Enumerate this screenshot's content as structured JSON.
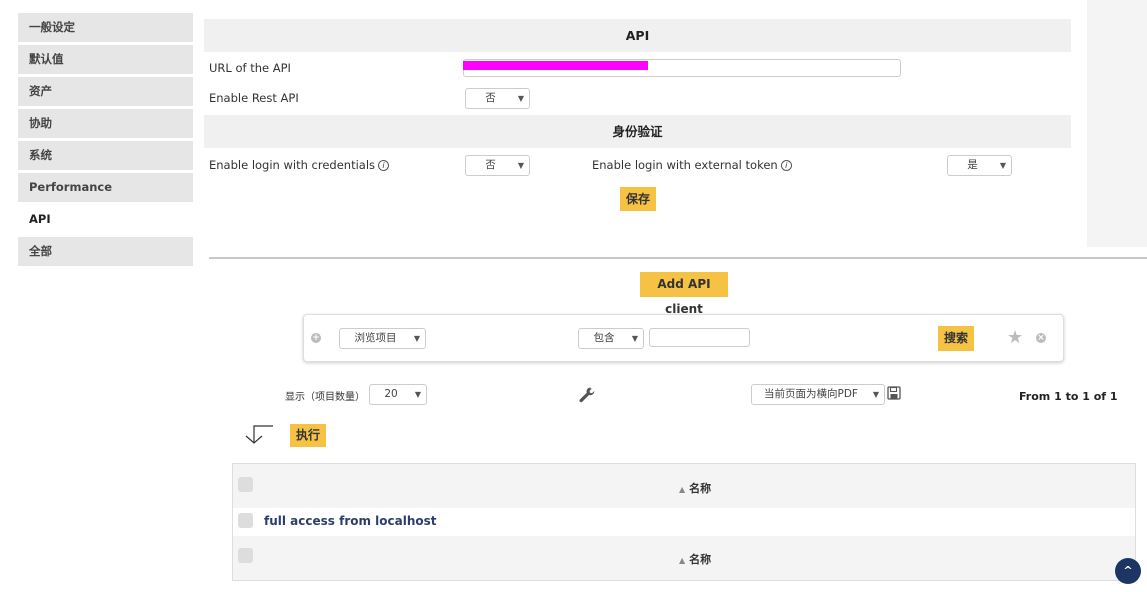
{
  "sidebar": {
    "items": [
      {
        "label": "一般设定"
      },
      {
        "label": "默认值"
      },
      {
        "label": "资产"
      },
      {
        "label": "协助"
      },
      {
        "label": "系统"
      },
      {
        "label": "Performance"
      },
      {
        "label": "API"
      },
      {
        "label": "全部"
      }
    ],
    "active": "API"
  },
  "api_section": {
    "title": "API",
    "url_label": "URL of the API",
    "url_value": "",
    "rest_label": "Enable Rest API",
    "rest_value": "否"
  },
  "auth_section": {
    "title": "身份验证",
    "credentials_label": "Enable login with credentials",
    "credentials_value": "否",
    "token_label": "Enable login with external token",
    "token_value": "是",
    "info_glyph": "i"
  },
  "save_button": "保存",
  "add_client_button": "Add API client",
  "search": {
    "field_value": "浏览项目",
    "operator_value": "包含",
    "query_value": "",
    "search_button": "搜索"
  },
  "listing": {
    "display_label": "显示（项目数量）",
    "page_size": "20",
    "export_value": "当前页面为横向PDF",
    "pagination": "From 1 to 1 of 1",
    "execute_button": "执行"
  },
  "table": {
    "column_header": "名称",
    "rows": [
      {
        "name": "full access from localhost"
      }
    ]
  },
  "colors": {
    "accent_yellow": "#f6c243",
    "link_blue": "#2d3e6a",
    "redaction": "#ff00ff"
  }
}
